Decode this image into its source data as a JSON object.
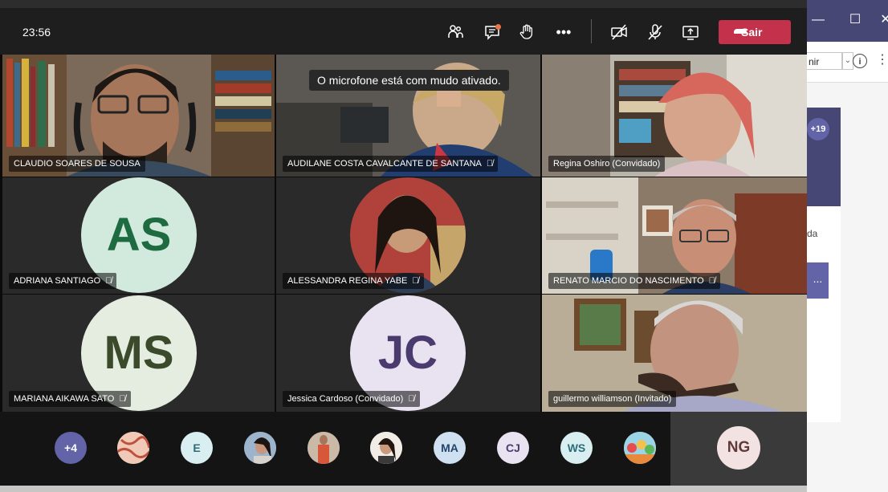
{
  "background_app": {
    "join_label": "nir",
    "badge": "+19",
    "card_text": "da",
    "card_button": "..."
  },
  "meeting": {
    "timer": "23:56",
    "leave_label": "Sair",
    "toast": "O microfone está com mudo ativado.",
    "colors": {
      "leave": "#c4314b",
      "toolbar": "#1e1e1e",
      "background": "#0b0b0b"
    },
    "toolbar_icons": [
      "participants-icon",
      "chat-icon",
      "raise-hand-icon",
      "more-actions-icon",
      "camera-off-icon",
      "mic-off-icon",
      "share-screen-icon",
      "leave-phone-icon"
    ]
  },
  "tiles": [
    {
      "name": "CLAUDIO SOARES DE SOUSA",
      "muted": false
    },
    {
      "name": "AUDILANE COSTA CAVALCANTE DE SANTANA",
      "muted": true
    },
    {
      "name": "Regina Oshiro (Convidado)",
      "muted": false
    },
    {
      "name": "ADRIANA SANTIAGO",
      "initials": "AS",
      "muted": true
    },
    {
      "name": "ALESSANDRA REGINA YABE",
      "muted": true
    },
    {
      "name": "RENATO MARCIO DO NASCIMENTO",
      "muted": true
    },
    {
      "name": "MARIANA AIKAWA SATO",
      "initials": "MS",
      "muted": true
    },
    {
      "name": "Jessica Cardoso (Convidado)",
      "initials": "JC",
      "muted": true
    },
    {
      "name": "guillermo williamson (Invitado)",
      "muted": false
    }
  ],
  "strip": {
    "overflow": "+4",
    "avatars": [
      "E",
      "MA",
      "CJ",
      "WS"
    ],
    "self_initials": "NG"
  }
}
